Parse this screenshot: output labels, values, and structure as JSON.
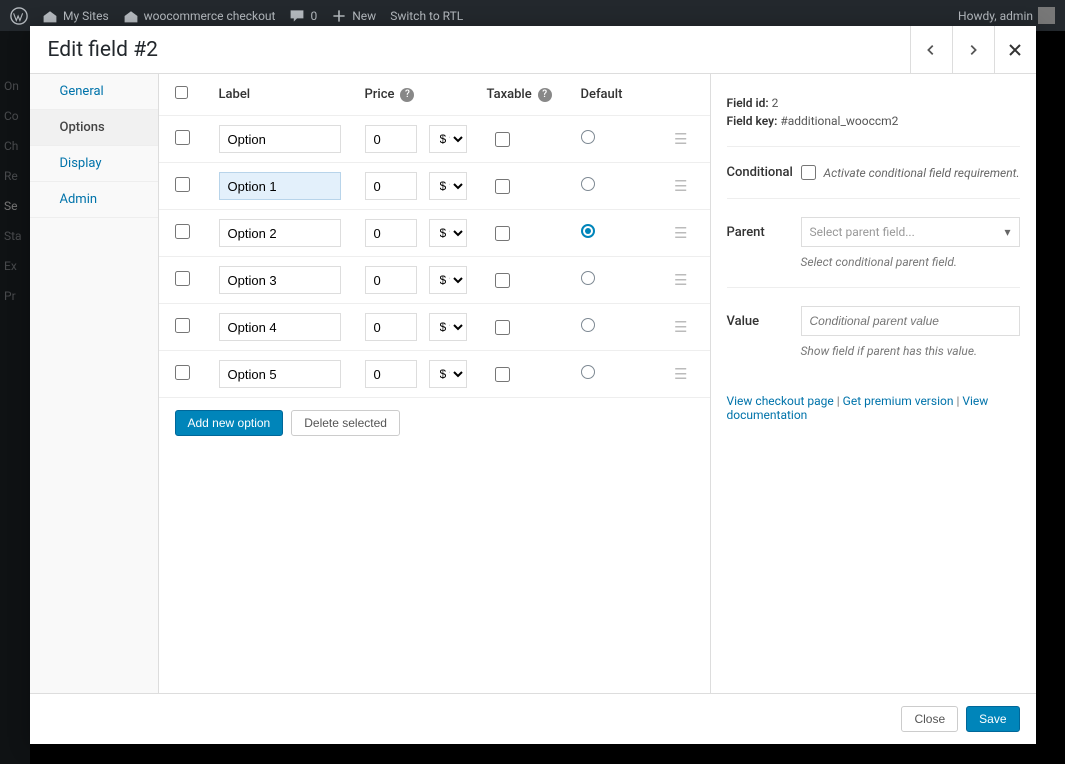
{
  "adminBar": {
    "mySites": "My Sites",
    "siteName": "woocommerce checkout",
    "comments": "0",
    "new": "New",
    "rtl": "Switch to RTL",
    "howdy": "Howdy, admin"
  },
  "backSidebar": {
    "items": [
      "On",
      "Co",
      "Ch",
      "Re",
      "Se",
      "Sta",
      "Ex",
      "Pr"
    ]
  },
  "modal": {
    "title": "Edit field #2",
    "tabs": {
      "general": "General",
      "options": "Options",
      "display": "Display",
      "admin": "Admin"
    },
    "activeTab": "options",
    "columns": {
      "label": "Label",
      "price": "Price",
      "taxable": "Taxable",
      "default": "Default"
    },
    "options": [
      {
        "label": "Option",
        "price": "0",
        "currency": "$",
        "taxable": false,
        "default": false,
        "highlighted": false
      },
      {
        "label": "Option 1",
        "price": "0",
        "currency": "$",
        "taxable": false,
        "default": false,
        "highlighted": true
      },
      {
        "label": "Option 2",
        "price": "0",
        "currency": "$",
        "taxable": false,
        "default": true,
        "highlighted": false
      },
      {
        "label": "Option 3",
        "price": "0",
        "currency": "$",
        "taxable": false,
        "default": false,
        "highlighted": false
      },
      {
        "label": "Option 4",
        "price": "0",
        "currency": "$",
        "taxable": false,
        "default": false,
        "highlighted": false
      },
      {
        "label": "Option 5",
        "price": "0",
        "currency": "$",
        "taxable": false,
        "default": false,
        "highlighted": false
      }
    ],
    "actions": {
      "add": "Add new option",
      "delete": "Delete selected"
    },
    "meta": {
      "fieldIdLabel": "Field id:",
      "fieldId": "2",
      "fieldKeyLabel": "Field key:",
      "fieldKey": "#additional_wooccm2",
      "conditionalLabel": "Conditional",
      "conditionalText": "Activate conditional field requirement.",
      "parentLabel": "Parent",
      "parentPlaceholder": "Select parent field...",
      "parentHint": "Select conditional parent field.",
      "valueLabel": "Value",
      "valuePlaceholder": "Conditional parent value",
      "valueHint": "Show field if parent has this value.",
      "links": {
        "checkout": "View checkout page",
        "premium": "Get premium version",
        "docs": "View documentation",
        "sep": " | "
      }
    },
    "footer": {
      "close": "Close",
      "save": "Save"
    }
  }
}
